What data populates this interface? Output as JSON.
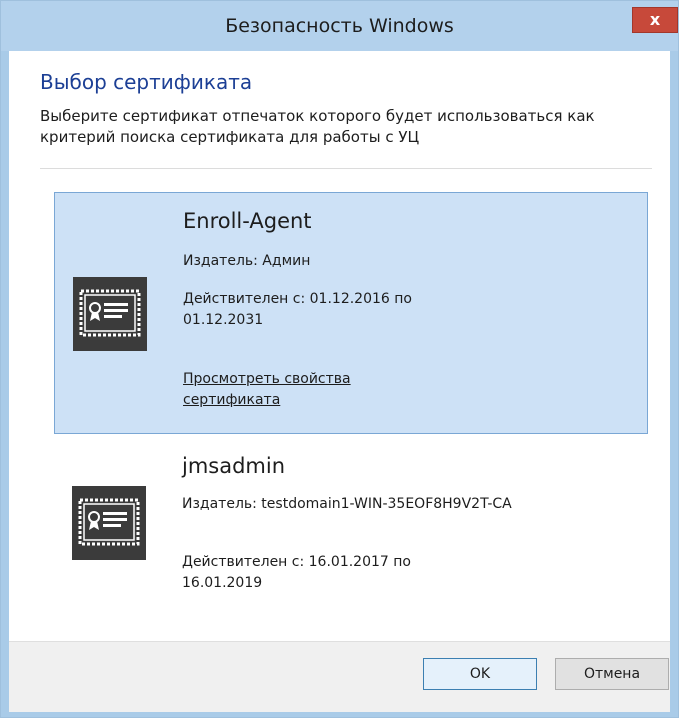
{
  "window": {
    "title": "Безопасность Windows",
    "close_label": "x"
  },
  "dialog": {
    "heading": "Выбор сертификата",
    "description": "Выберите сертификат отпечаток которого будет использоваться как критерий поиска сертификата для работы с УЦ"
  },
  "certificates": [
    {
      "name": "Enroll-Agent",
      "issuer": "Издатель: Админ",
      "valid": "Действителен с: 01.12.2016 по 01.12.2031",
      "properties_link": "Просмотреть свойства сертификата",
      "selected": true,
      "icon": "certificate-icon"
    },
    {
      "name": "jmsadmin",
      "issuer": "Издатель: testdomain1-WIN-35EOF8H9V2T-CA",
      "valid": "Действителен с: 16.01.2017 по 16.01.2019",
      "selected": false,
      "icon": "certificate-icon"
    }
  ],
  "buttons": {
    "ok": "OK",
    "cancel": "Отмена"
  },
  "colors": {
    "title_bar": "#b3d1ec",
    "heading": "#1c3f95",
    "selected_bg": "#cde1f6",
    "selected_border": "#7aa7d5",
    "close_button": "#c7493a"
  }
}
